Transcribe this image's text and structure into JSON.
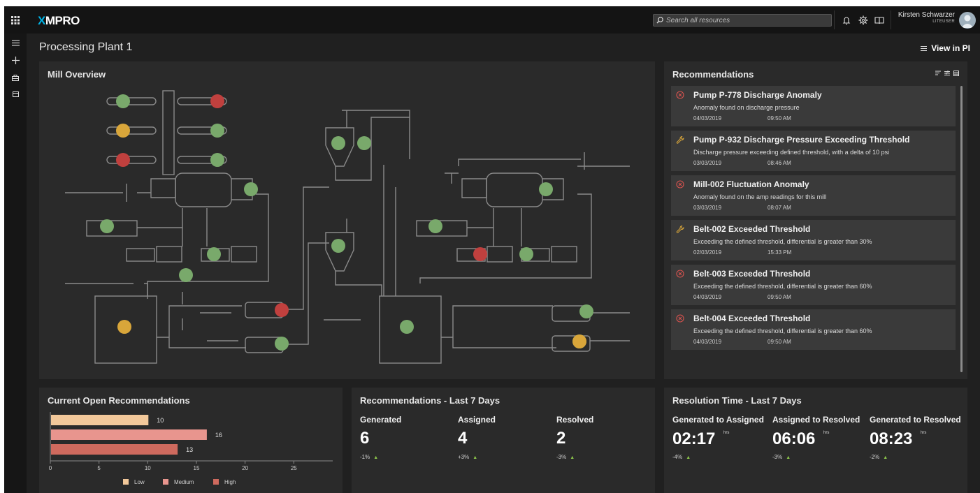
{
  "header": {
    "logo": {
      "x": "X",
      "rest": "MPRO"
    },
    "search_placeholder": "Search all resources",
    "user_name": "Kirsten Schwarzer",
    "user_role": "LITEUSER",
    "icons": [
      "apps-grid-icon",
      "bell-icon",
      "gear-icon",
      "book-icon",
      "avatar"
    ]
  },
  "sidenav": {
    "icons": [
      "menu-icon",
      "plus-icon",
      "dashboard-icon",
      "box-icon"
    ]
  },
  "page": {
    "title": "Processing Plant 1",
    "view_in_pi": "View in PI"
  },
  "mill": {
    "title": "Mill Overview",
    "indicator_colors": {
      "ok": "#79a96b",
      "warning": "#d9a63a",
      "alarm": "#c0403e"
    },
    "indicators": [
      "ok",
      "alarm",
      "warning",
      "ok",
      "alarm",
      "ok",
      "ok",
      "ok",
      "ok",
      "ok",
      "ok",
      "alarm",
      "ok",
      "warning",
      "ok",
      "ok",
      "ok",
      "ok",
      "alarm",
      "ok",
      "ok",
      "ok",
      "ok",
      "warning"
    ]
  },
  "recommendations": {
    "title": "Recommendations",
    "items": [
      {
        "type": "alarm",
        "title": "Pump P-778 Discharge Anomaly",
        "desc": "Anomaly found on discharge pressure",
        "date": "04/03/2019",
        "time": "09:50 AM"
      },
      {
        "type": "maintenance",
        "title": "Pump P-932 Discharge Pressure Exceeding Threshold",
        "desc": "Discharge pressure exceeding defined threshold, with a delta of 10 psi",
        "date": "03/03/2019",
        "time": "08:46 AM"
      },
      {
        "type": "alarm",
        "title": "Mill-002 Fluctuation Anomaly",
        "desc": "Anomaly found on the amp readings for this mill",
        "date": "03/03/2019",
        "time": "08:07 AM"
      },
      {
        "type": "maintenance",
        "title": "Belt-002 Exceeded Threshold",
        "desc": "Exceeding the defined threshold, differential is greater than 30%",
        "date": "02/03/2019",
        "time": "15:33 PM"
      },
      {
        "type": "alarm",
        "title": "Belt-003 Exceeded Threshold",
        "desc": "Exceeding the defined threshold, differential is greater than 60%",
        "date": "04/03/2019",
        "time": "09:50 AM"
      },
      {
        "type": "alarm",
        "title": "Belt-004 Exceeded Threshold",
        "desc": "Exceeding the defined threshold, differential is greater than 60%",
        "date": "04/03/2019",
        "time": "09:50 AM"
      }
    ]
  },
  "open_recs": {
    "title": "Current Open Recommendations",
    "chart_data": {
      "type": "bar",
      "orientation": "horizontal",
      "categories": [
        "Low",
        "Medium",
        "High"
      ],
      "values": [
        10,
        16,
        13
      ],
      "colors": [
        "#f2c89a",
        "#e8958e",
        "#cf6a5e"
      ],
      "x_ticks": [
        0,
        5,
        10,
        15,
        20,
        25
      ],
      "xlim": [
        0,
        29
      ],
      "legend": [
        "Low",
        "Medium",
        "High"
      ],
      "legend_position": "bottom"
    }
  },
  "last7": {
    "title": "Recommendations - Last 7 Days",
    "metrics": [
      {
        "label": "Generated",
        "value": "6",
        "change": "-1%"
      },
      {
        "label": "Assigned",
        "value": "4",
        "change": "+3%"
      },
      {
        "label": "Resolved",
        "value": "2",
        "change": "-3%"
      }
    ]
  },
  "restime": {
    "title": "Resolution Time - Last 7 Days",
    "unit": "hrs",
    "metrics": [
      {
        "label": "Generated to Assigned",
        "value": "02:17",
        "change": "-4%"
      },
      {
        "label": "Assigned to Resolved",
        "value": "06:06",
        "change": "-3%"
      },
      {
        "label": "Generated to Resolved",
        "value": "08:23",
        "change": "-2%"
      }
    ]
  }
}
